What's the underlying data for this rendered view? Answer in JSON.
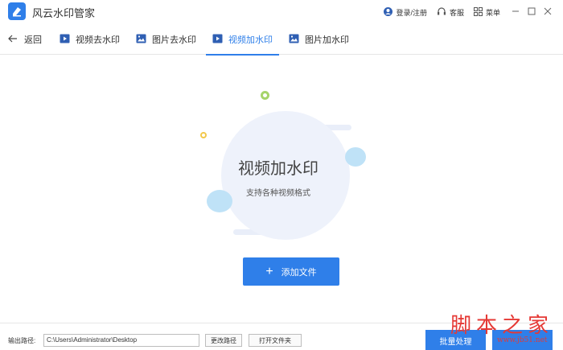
{
  "app": {
    "title": "风云水印管家",
    "brand_color": "#2f7fe9"
  },
  "titlebar": {
    "login_label": "登录/注册",
    "service_label": "客服",
    "menu_label": "菜单",
    "icons": [
      "user-icon",
      "headset-icon",
      "menu-grid-icon",
      "minimize-icon",
      "maximize-icon",
      "close-icon"
    ]
  },
  "nav": {
    "back_label": "返回",
    "tabs": [
      {
        "label": "视频去水印",
        "icon": "video-icon",
        "active": false
      },
      {
        "label": "图片去水印",
        "icon": "image-icon",
        "active": false
      },
      {
        "label": "视频加水印",
        "icon": "video-icon",
        "active": true
      },
      {
        "label": "图片加水印",
        "icon": "image-icon",
        "active": false
      }
    ]
  },
  "main": {
    "title": "视频加水印",
    "subtitle": "支持各种视频格式",
    "add_button_label": "添加文件"
  },
  "footer": {
    "output_label": "输出路径:",
    "output_path": "C:\\Users\\Administrator\\Desktop",
    "change_path_label": "更改路径",
    "open_folder_label": "打开文件夹",
    "batch_label": "批量处理"
  },
  "watermark": {
    "text": "脚本之家",
    "url": "www.jb51.net"
  }
}
